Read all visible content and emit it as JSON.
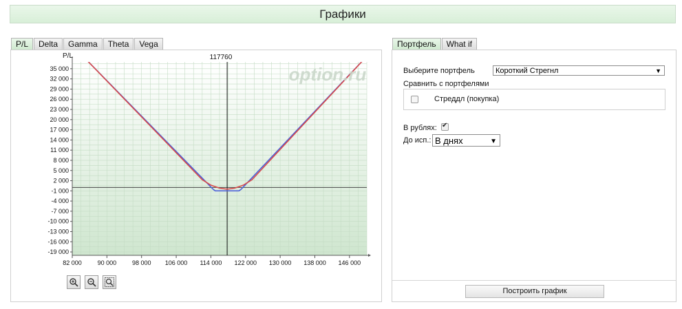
{
  "page": {
    "title": "Графики"
  },
  "chart_tabs": [
    {
      "label": "P/L",
      "active": true
    },
    {
      "label": "Delta",
      "active": false
    },
    {
      "label": "Gamma",
      "active": false
    },
    {
      "label": "Theta",
      "active": false
    },
    {
      "label": "Vega",
      "active": false
    }
  ],
  "right_tabs": [
    {
      "label": "Портфель",
      "active": true
    },
    {
      "label": "What if",
      "active": false
    }
  ],
  "form": {
    "portfolio_label": "Выберите портфель",
    "portfolio_value": "Короткий Стрегнл",
    "compare_label": "Сравнить с портфелями",
    "compare_item": "Стреддл (покупка)",
    "compare_checked": false,
    "rubles_label": "В рублях:",
    "rubles_checked": true,
    "expiry_label": "До исп.:",
    "expiry_value": "В днях",
    "build_button": "Построить график"
  },
  "zoom": {
    "zoom_in": "zoom-in-icon",
    "zoom_out": "zoom-out-icon",
    "zoom_fit": "zoom-fit-icon"
  },
  "chart_data": {
    "type": "line",
    "y_axis_title": "P/L",
    "watermark": "option.ru",
    "current_price_label": "117760",
    "current_price": 117760,
    "xlim": [
      82000,
      150000
    ],
    "ylim": [
      -20000,
      37000
    ],
    "x_ticks": [
      "82 000",
      "90 000",
      "98 000",
      "106 000",
      "114 000",
      "122 000",
      "130 000",
      "138 000",
      "146 000"
    ],
    "y_ticks": [
      "35 000",
      "32 000",
      "29 000",
      "26 000",
      "23 000",
      "20 000",
      "17 000",
      "14 000",
      "11 000",
      "8 000",
      "5 000",
      "2 000",
      "-1 000",
      "-4 000",
      "-7 000",
      "-10 000",
      "-13 000",
      "-16 000",
      "-19 000"
    ],
    "grid": true,
    "colors": {
      "expiration": "#4a5fd8",
      "current": "#d84a4a",
      "plot_bg_top": "#ffffff",
      "plot_bg_bottom": "#cfe6cf",
      "grid": "#c4dcc4"
    },
    "series": [
      {
        "name": "",
        "role": "expiration",
        "x": [
          85000,
          114500,
          115000,
          120500,
          121000,
          149500
        ],
        "y": [
          38000,
          -500,
          -1000,
          -1000,
          -500,
          38000
        ]
      },
      {
        "name": "",
        "role": "current",
        "x": [
          85000,
          112000,
          114000,
          116000,
          117760,
          119500,
          121500,
          123500,
          149500
        ],
        "y": [
          38000,
          2300,
          700,
          -200,
          -500,
          -200,
          700,
          2300,
          38000
        ]
      }
    ]
  }
}
